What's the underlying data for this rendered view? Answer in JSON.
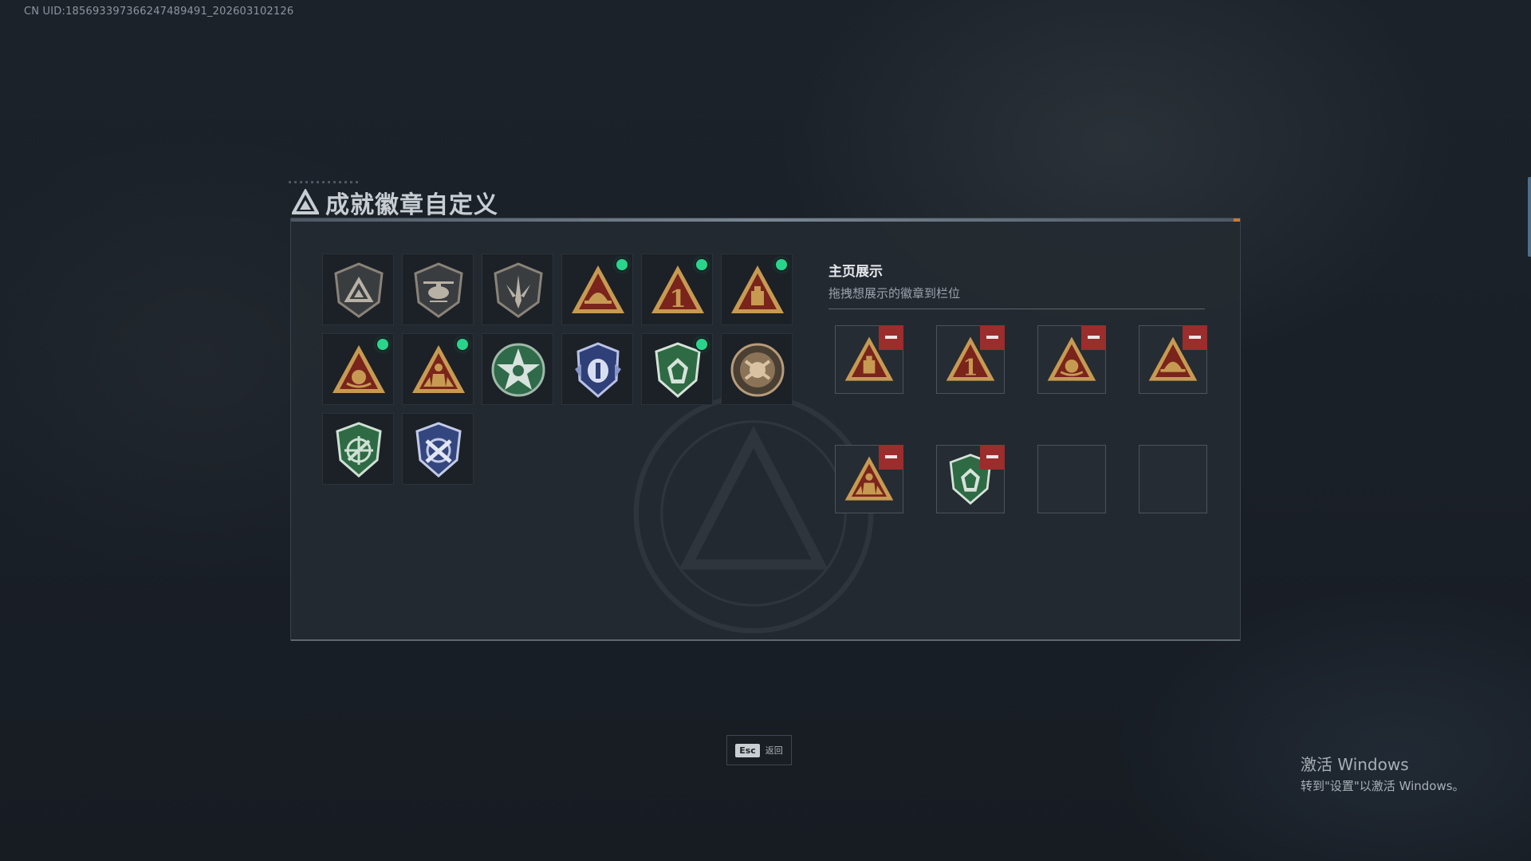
{
  "uid_text": "CN UID:1856933973662474894​91_202603102126",
  "title": "成就徽章自定义",
  "showcase": {
    "title": "主页展示",
    "hint": "拖拽想展示的徽章到栏位"
  },
  "badges": [
    {
      "icon": "triangle-shield-badge-icon",
      "new": false
    },
    {
      "icon": "helicopter-shield-badge-icon",
      "new": false
    },
    {
      "icon": "sword-shield-badge-icon",
      "new": false
    },
    {
      "icon": "gold-triangle-helmet-badge-icon",
      "new": true
    },
    {
      "icon": "gold-triangle-number-one-badge-icon",
      "new": true
    },
    {
      "icon": "gold-triangle-crate-badge-icon",
      "new": true
    },
    {
      "icon": "gold-triangle-emblem-badge-icon",
      "new": true
    },
    {
      "icon": "gold-triangle-soldier-badge-icon",
      "new": true
    },
    {
      "icon": "green-star-medal-badge-icon",
      "new": false
    },
    {
      "icon": "blue-shield-crest-badge-icon",
      "new": false
    },
    {
      "icon": "green-shield-gem-badge-icon",
      "new": true
    },
    {
      "icon": "bronze-round-emblem-badge-icon",
      "new": false
    },
    {
      "icon": "green-crosshair-shield-badge-icon",
      "new": false
    },
    {
      "icon": "blue-crossed-rifles-shield-badge-icon",
      "new": false
    }
  ],
  "slots": [
    {
      "icon": "gold-triangle-crate-badge-icon",
      "filled": true
    },
    {
      "icon": "gold-triangle-number-one-badge-icon",
      "filled": true
    },
    {
      "icon": "gold-triangle-emblem-badge-icon",
      "filled": true
    },
    {
      "icon": "gold-triangle-helmet-badge-icon",
      "filled": true
    },
    {
      "icon": "gold-triangle-soldier-badge-icon",
      "filled": true
    },
    {
      "icon": "green-shield-gem-badge-icon",
      "filled": true
    },
    {
      "filled": false
    },
    {
      "filled": false
    }
  ],
  "esc": {
    "key": "Esc",
    "label": "返回"
  },
  "windows": {
    "line1": "激活 Windows",
    "line2": "转到\"设置\"以激活 Windows。"
  },
  "colors": {
    "gold": "#c79a52",
    "dark_red": "#7a241c",
    "green_dot": "#27d68a",
    "remove_red": "#9b2d2d"
  }
}
